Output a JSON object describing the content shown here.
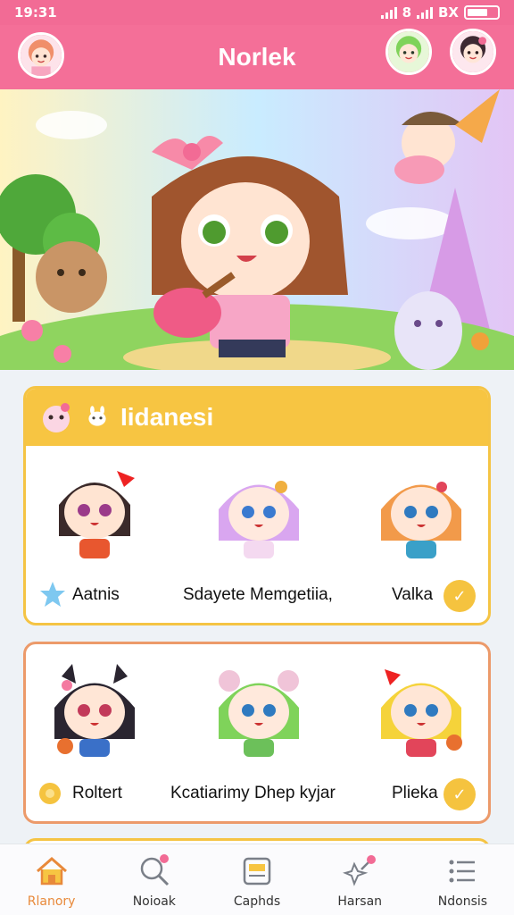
{
  "status_bar": {
    "time": "19:31",
    "right_text": "8",
    "battery_text": "BX"
  },
  "header": {
    "title": "Norlek"
  },
  "section": {
    "title": "Iidanesi"
  },
  "row1": {
    "items": [
      {
        "name": "Aatnis"
      },
      {
        "name": "Sdayete Memgetiia,"
      },
      {
        "name": "Valka"
      }
    ]
  },
  "row2": {
    "items": [
      {
        "name": "Roltert"
      },
      {
        "name": "Kcatiarimy Dhep kyjar"
      },
      {
        "name": "Plieka"
      }
    ]
  },
  "bottom_nav": {
    "items": [
      {
        "label": "Rlanory",
        "icon": "home-icon",
        "active": true
      },
      {
        "label": "Noioak",
        "icon": "search-icon",
        "active": false
      },
      {
        "label": "Caphds",
        "icon": "cards-icon",
        "active": false
      },
      {
        "label": "Harsan",
        "icon": "magic-wand-icon",
        "active": false
      },
      {
        "label": "Ndonsis",
        "icon": "menu-list-icon",
        "active": false
      }
    ]
  },
  "colors": {
    "header": "#f46f98",
    "accent": "#f7c542",
    "card2_border": "#ec9a6a",
    "active_nav": "#e8893a"
  }
}
